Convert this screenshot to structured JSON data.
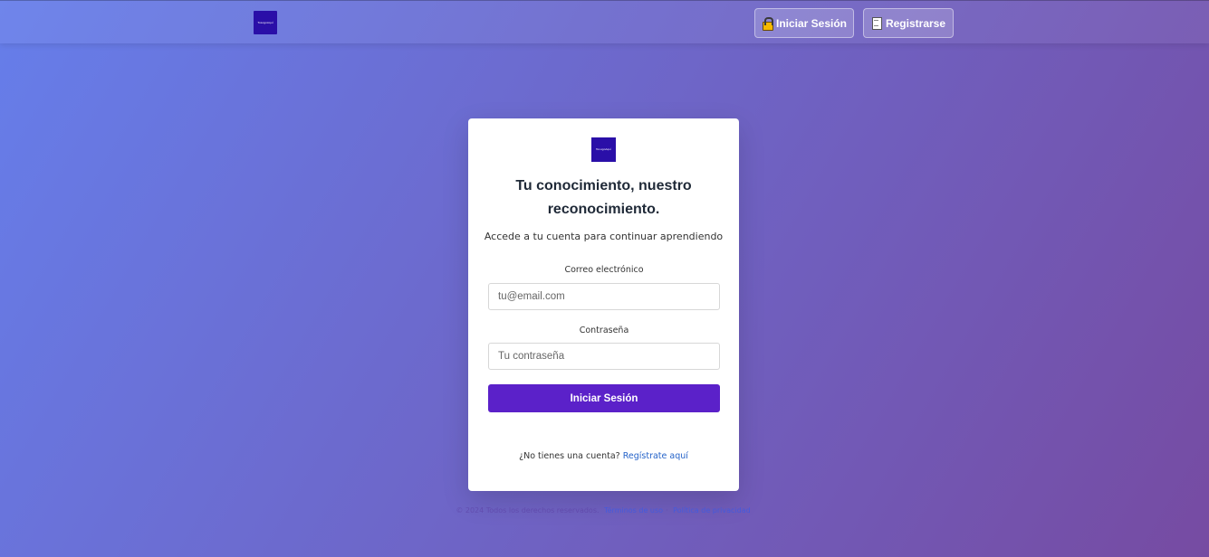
{
  "navbar": {
    "logo_text": "TuLogoAquí",
    "login_label": "Iniciar Sesión",
    "login_icon": "lock-icon",
    "register_label": "Registrarse",
    "register_icon": "memo-icon"
  },
  "card": {
    "logo_text": "TuLogoAquí",
    "title": "Tu conocimiento, nuestro reconocimiento.",
    "subtitle": "Accede a tu cuenta para continuar aprendiendo",
    "email_label": "Correo electrónico",
    "email_placeholder": "tu@email.com",
    "password_label": "Contraseña",
    "password_placeholder": "Tu contraseña",
    "submit_label": "Iniciar Sesión",
    "signup_prompt": "¿No tienes una cuenta?",
    "signup_link": "Regístrate aquí"
  },
  "footer": {
    "copyright": "© 2024 Todos los derechos reservados.",
    "terms_link": "Términos de uso",
    "privacy_link": "Política de privacidad"
  },
  "colors": {
    "gradient_start": "#667eea",
    "gradient_end": "#764ba2",
    "primary_button": "#5b21c9",
    "logo_bg": "#2a0fa8",
    "link": "#2563c9"
  }
}
